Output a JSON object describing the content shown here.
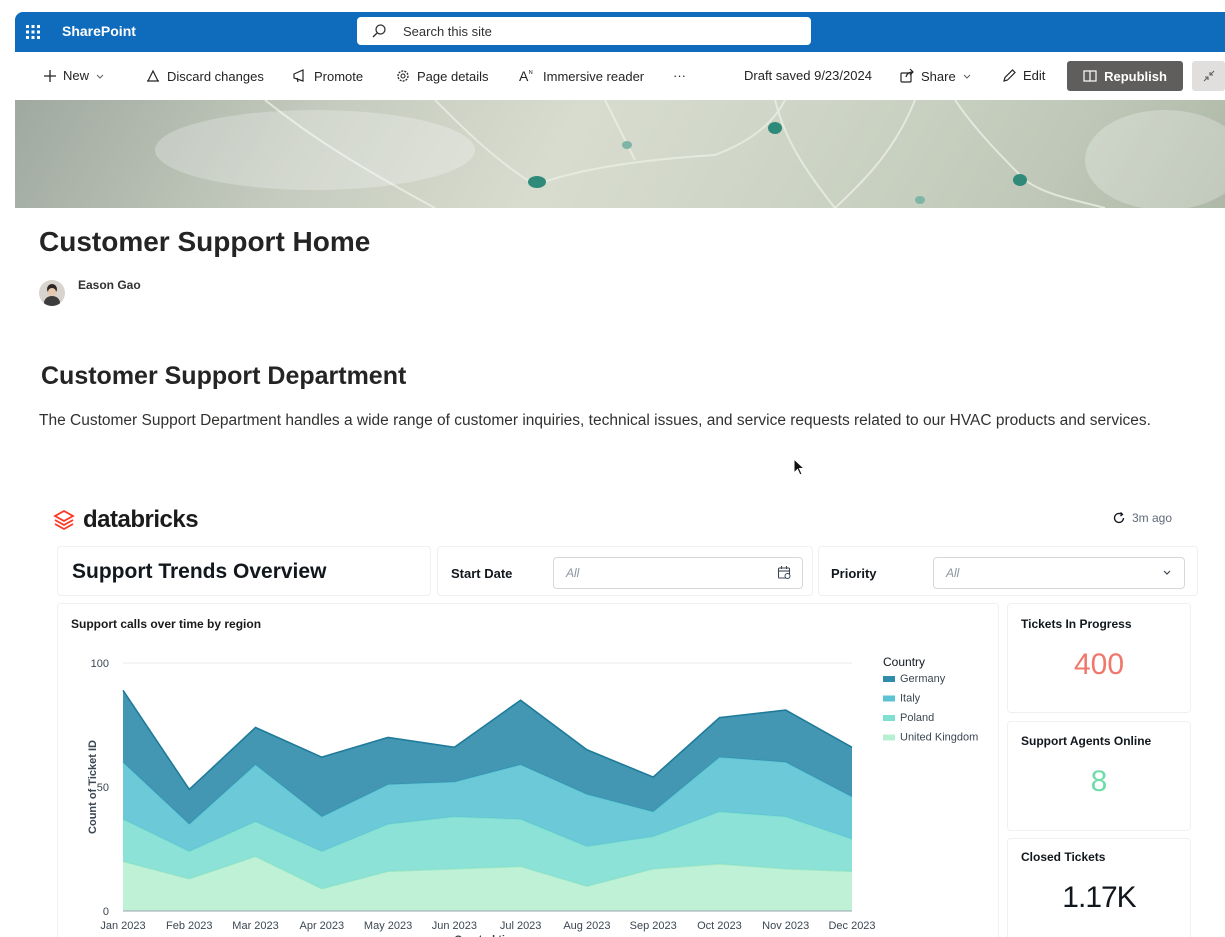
{
  "suitebar": {
    "app_name": "SharePoint",
    "search_placeholder": "Search this site"
  },
  "commandbar": {
    "new": "New",
    "discard": "Discard changes",
    "promote": "Promote",
    "page_details": "Page details",
    "immersive_reader": "Immersive reader",
    "more": "···",
    "draft_status": "Draft saved 9/23/2024",
    "share": "Share",
    "edit": "Edit",
    "republish": "Republish"
  },
  "page": {
    "title": "Customer Support Home",
    "author": "Eason Gao",
    "section_title": "Customer Support Department",
    "description": "The Customer Support Department handles a wide range of customer inquiries, technical issues, and service requests related to our HVAC products and services."
  },
  "embed": {
    "brand": "databricks",
    "refreshed": "3m ago",
    "dashboard_title": "Support Trends Overview",
    "filters": [
      {
        "label": "Start Date",
        "value": "All"
      },
      {
        "label": "Priority",
        "value": "All"
      }
    ],
    "chart_title": "Support calls over time by region",
    "kpis": [
      {
        "label": "Tickets In Progress",
        "value": "400",
        "color": "#f0776b"
      },
      {
        "label": "Support Agents Online",
        "value": "8",
        "color": "#6fdca9"
      },
      {
        "label": "Closed Tickets",
        "value": "1.17K",
        "color": "#11171c"
      }
    ]
  },
  "chart_data": {
    "type": "area",
    "stacked": true,
    "title": "Support calls over time by region",
    "xlabel": "Created time",
    "ylabel": "Count of Ticket ID",
    "ylim": [
      0,
      100
    ],
    "yticks": [
      0,
      50,
      100
    ],
    "categories": [
      "Jan 2023",
      "Feb 2023",
      "Mar 2023",
      "Apr 2023",
      "May 2023",
      "Jun 2023",
      "Jul 2023",
      "Aug 2023",
      "Sep 2023",
      "Oct 2023",
      "Nov 2023",
      "Dec 2023"
    ],
    "legend_title": "Country",
    "legend_position": "right",
    "series": [
      {
        "name": "United Kingdom",
        "color": "#b7efd2",
        "values": [
          20,
          13,
          22,
          9,
          16,
          17,
          18,
          10,
          17,
          19,
          17,
          16
        ]
      },
      {
        "name": "Poland",
        "color": "#7fdfd1",
        "values": [
          17,
          11,
          14,
          15,
          19,
          21,
          19,
          16,
          13,
          21,
          21,
          13
        ]
      },
      {
        "name": "Italy",
        "color": "#5cc3d3",
        "values": [
          23,
          11,
          23,
          14,
          16,
          14,
          22,
          21,
          10,
          22,
          22,
          17
        ]
      },
      {
        "name": "Germany",
        "color": "#2f8cab",
        "values": [
          29,
          14,
          15,
          24,
          19,
          14,
          26,
          18,
          14,
          16,
          21,
          20
        ]
      }
    ]
  }
}
